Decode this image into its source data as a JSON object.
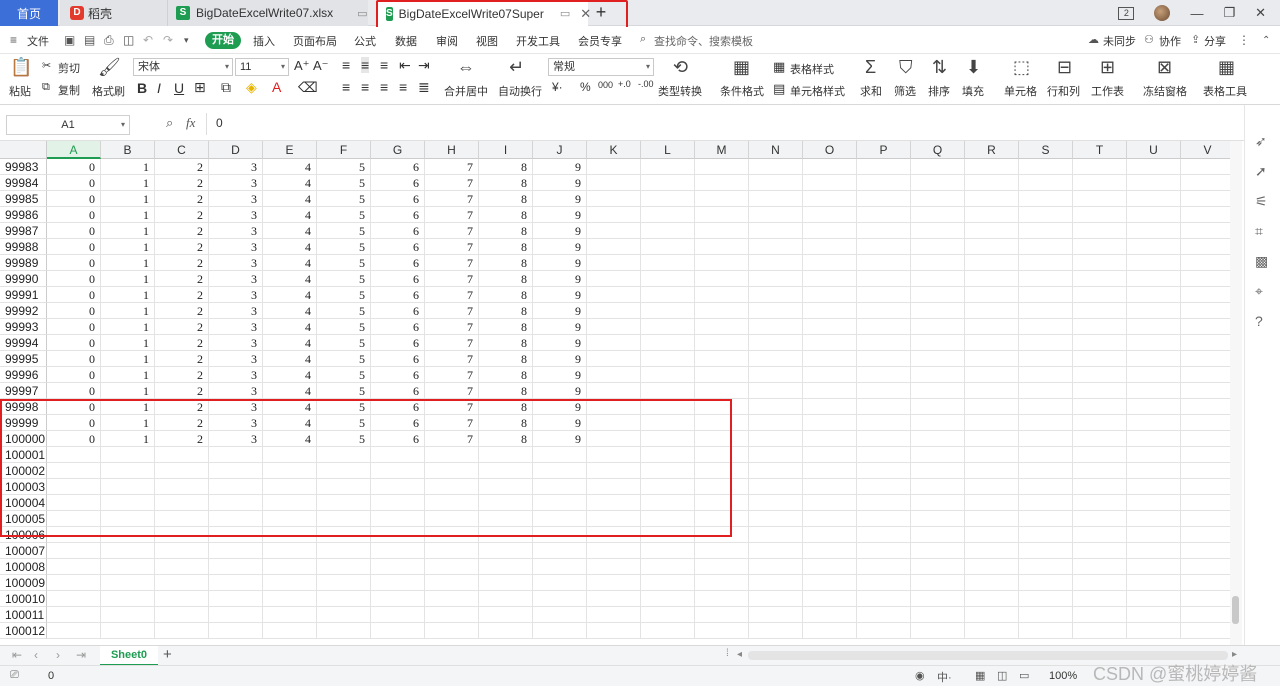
{
  "tabs": {
    "home": "首页",
    "daoke": "稻壳",
    "file1": "BigDateExcelWrite07.xlsx",
    "file2": "BigDateExcelWrite07Super",
    "add": "+"
  },
  "window": {
    "badge": "2"
  },
  "menu": {
    "file": "文件",
    "start": "开始",
    "items": [
      "插入",
      "页面布局",
      "公式",
      "数据",
      "审阅",
      "视图",
      "开发工具",
      "会员专享"
    ],
    "search": "查找命令、搜索模板",
    "sync": "未同步",
    "collab": "协作",
    "share": "分享"
  },
  "ribbon": {
    "paste": "粘贴",
    "cut": "剪切",
    "copy": "复制",
    "format_painter": "格式刷",
    "font_name": "宋体",
    "font_size": "11",
    "merge": "合并居中",
    "wrap": "自动换行",
    "number_format": "常规",
    "type_convert": "类型转换",
    "cond_format": "条件格式",
    "table_style": "表格样式",
    "cell_style": "单元格样式",
    "sum": "求和",
    "filter": "筛选",
    "sort": "排序",
    "fill": "填充",
    "cell": "单元格",
    "row_col": "行和列",
    "worksheet": "工作表",
    "freeze": "冻结窗格",
    "table_tools": "表格工具"
  },
  "formula_bar": {
    "name_box": "A1",
    "fx": "fx",
    "value": "0"
  },
  "columns": [
    "A",
    "B",
    "C",
    "D",
    "E",
    "F",
    "G",
    "H",
    "I",
    "J",
    "K",
    "L",
    "M",
    "N",
    "O",
    "P",
    "Q",
    "R",
    "S",
    "T",
    "U",
    "V"
  ],
  "rows": [
    "99983",
    "99984",
    "99985",
    "99986",
    "99987",
    "99988",
    "99989",
    "99990",
    "99991",
    "99992",
    "99993",
    "99994",
    "99995",
    "99996",
    "99997",
    "99998",
    "99999",
    "100000",
    "100001",
    "100002",
    "100003",
    "100004",
    "100005",
    "100006",
    "100007",
    "100008",
    "100009",
    "100010",
    "100011",
    "100012"
  ],
  "cell_values": [
    "0",
    "1",
    "2",
    "3",
    "4",
    "5",
    "6",
    "7",
    "8",
    "9"
  ],
  "filled_row_count": 18,
  "sheet_tab": "Sheet0",
  "status": {
    "value": "0",
    "zoom": "100%"
  },
  "watermark": "CSDN @蜜桃婷婷酱"
}
